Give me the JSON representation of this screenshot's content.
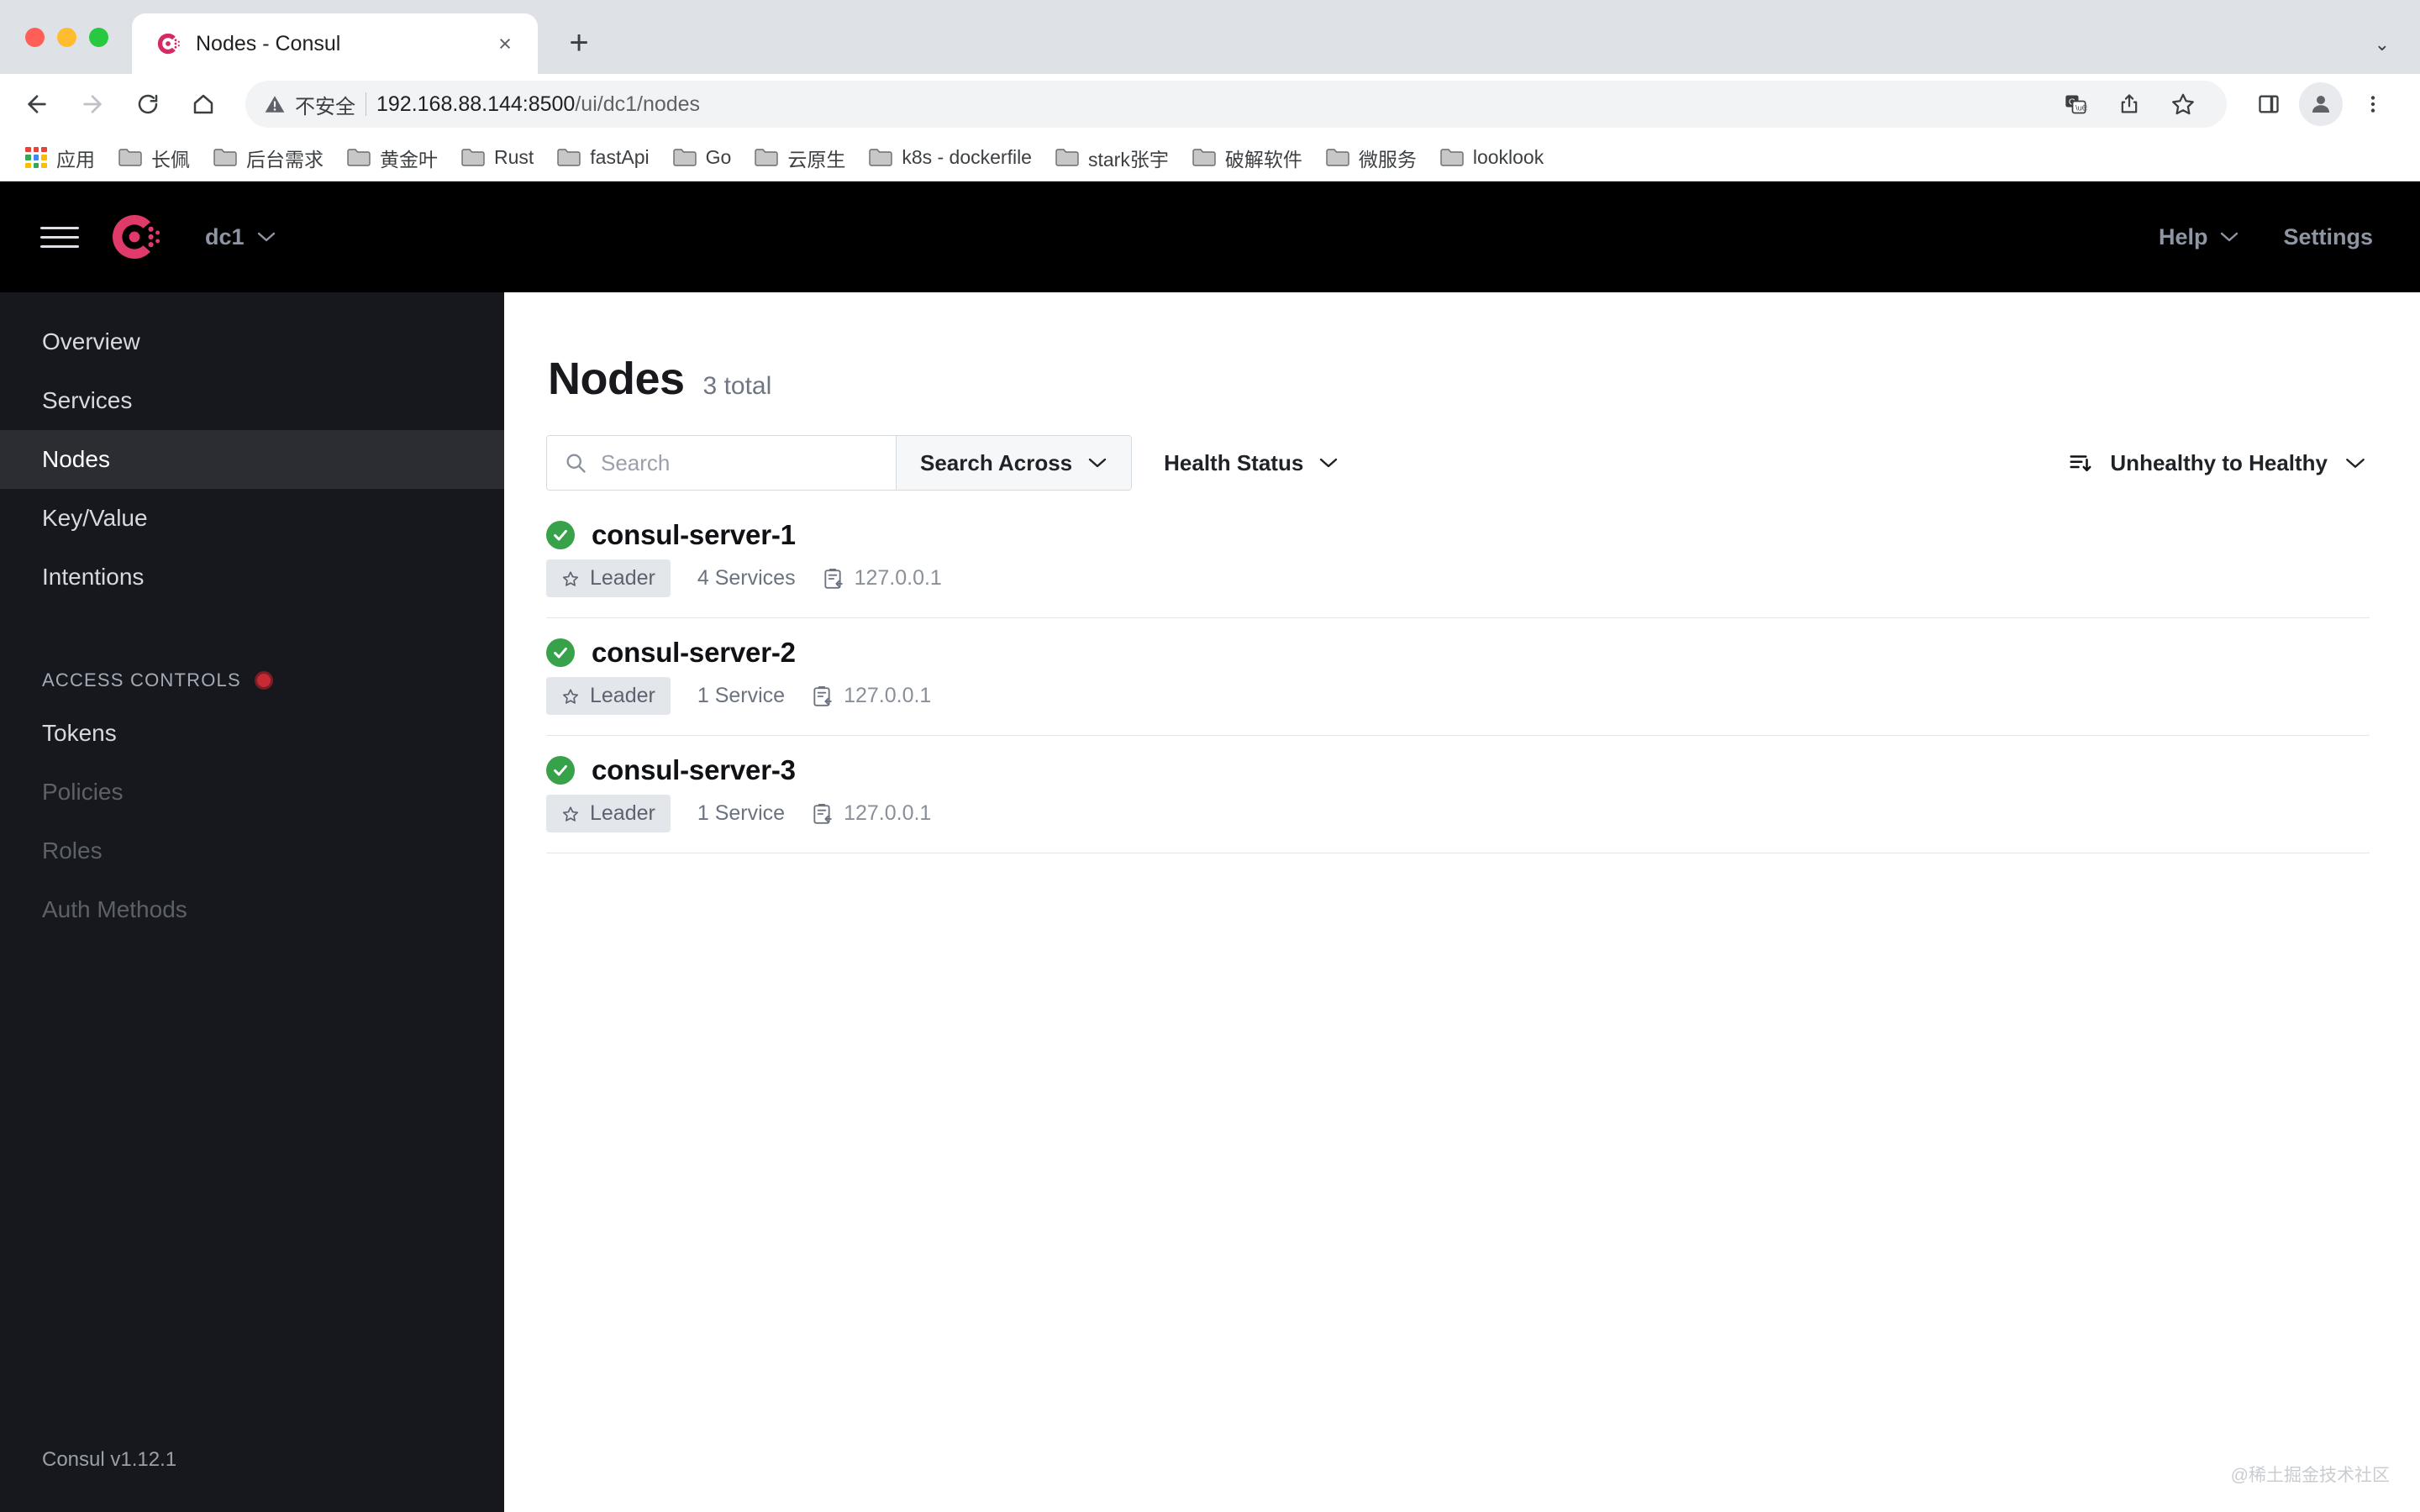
{
  "browser": {
    "tab": {
      "title": "Nodes - Consul",
      "favicon": "consul-favicon",
      "close": "×"
    },
    "newtab_label": "+",
    "window_caret": "⌄",
    "omnibox": {
      "warning_icon": "not-secure-icon",
      "warning_text": "不安全",
      "url_host": "192.168.88.144:8500",
      "url_path": "/ui/dc1/nodes"
    },
    "nav_buttons": [
      "back-arrow",
      "forward-arrow",
      "reload",
      "home"
    ],
    "toolbar_actions": [
      "translate-icon",
      "share-icon",
      "bookmark-star-icon",
      "side-panel-icon",
      "profile-avatar",
      "chrome-menu-icon"
    ],
    "bookmarks": [
      {
        "label": "应用",
        "icon": "apps-grid-icon"
      },
      {
        "label": "长佩",
        "icon": "folder-icon"
      },
      {
        "label": "后台需求",
        "icon": "folder-icon"
      },
      {
        "label": "黄金叶",
        "icon": "folder-icon"
      },
      {
        "label": "Rust",
        "icon": "folder-icon"
      },
      {
        "label": "fastApi",
        "icon": "folder-icon"
      },
      {
        "label": "Go",
        "icon": "folder-icon"
      },
      {
        "label": "云原生",
        "icon": "folder-icon"
      },
      {
        "label": "k8s - dockerfile",
        "icon": "folder-icon"
      },
      {
        "label": "stark张宇",
        "icon": "folder-icon"
      },
      {
        "label": "破解软件",
        "icon": "folder-icon"
      },
      {
        "label": "微服务",
        "icon": "folder-icon"
      },
      {
        "label": "looklook",
        "icon": "folder-icon"
      }
    ]
  },
  "header": {
    "menu_icon": "hamburger-icon",
    "logo": "consul-logo",
    "datacenter": "dc1",
    "datacenter_caret": "∨",
    "help_label": "Help",
    "help_caret": "∨",
    "settings_label": "Settings"
  },
  "sidebar": {
    "items": [
      {
        "label": "Overview",
        "state": "normal"
      },
      {
        "label": "Services",
        "state": "normal"
      },
      {
        "label": "Nodes",
        "state": "active"
      },
      {
        "label": "Key/Value",
        "state": "normal"
      },
      {
        "label": "Intentions",
        "state": "normal"
      }
    ],
    "section_label": "ACCESS CONTROLS",
    "section_badge_color": "#c62a35",
    "acl_items": [
      {
        "label": "Tokens",
        "state": "normal"
      },
      {
        "label": "Policies",
        "state": "disabled"
      },
      {
        "label": "Roles",
        "state": "disabled"
      },
      {
        "label": "Auth Methods",
        "state": "disabled"
      }
    ],
    "version": "Consul v1.12.1"
  },
  "main": {
    "title": "Nodes",
    "count": "3 total",
    "search": {
      "placeholder": "Search",
      "value": "",
      "icon": "search-icon"
    },
    "search_across": {
      "label": "Search Across",
      "caret": "∨"
    },
    "health_status": {
      "label": "Health Status",
      "caret": "∨"
    },
    "sort": {
      "icon": "sort-desc-icon",
      "label": "Unhealthy to Healthy",
      "caret": "∨"
    },
    "nodes": [
      {
        "name": "consul-server-1",
        "health": "passing",
        "health_color": "#37a24a",
        "leader_label": "Leader",
        "services": "4 Services",
        "address": "127.0.0.1"
      },
      {
        "name": "consul-server-2",
        "health": "passing",
        "health_color": "#37a24a",
        "leader_label": "Leader",
        "services": "1 Service",
        "address": "127.0.0.1"
      },
      {
        "name": "consul-server-3",
        "health": "passing",
        "health_color": "#37a24a",
        "leader_label": "Leader",
        "services": "1 Service",
        "address": "127.0.0.1"
      }
    ]
  },
  "watermark": "@稀土掘金技术社区"
}
